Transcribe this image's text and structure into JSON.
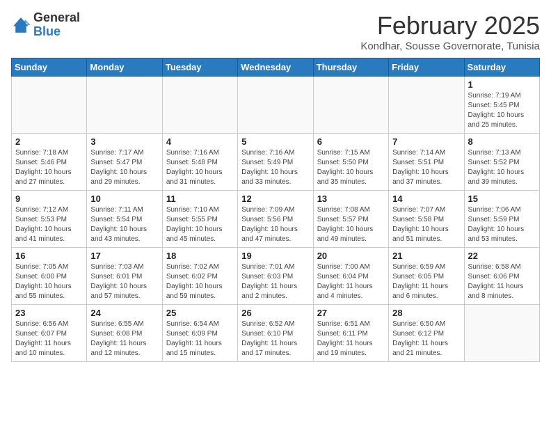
{
  "logo": {
    "general": "General",
    "blue": "Blue"
  },
  "title": "February 2025",
  "location": "Kondhar, Sousse Governorate, Tunisia",
  "days_of_week": [
    "Sunday",
    "Monday",
    "Tuesday",
    "Wednesday",
    "Thursday",
    "Friday",
    "Saturday"
  ],
  "weeks": [
    [
      {
        "day": "",
        "info": ""
      },
      {
        "day": "",
        "info": ""
      },
      {
        "day": "",
        "info": ""
      },
      {
        "day": "",
        "info": ""
      },
      {
        "day": "",
        "info": ""
      },
      {
        "day": "",
        "info": ""
      },
      {
        "day": "1",
        "info": "Sunrise: 7:19 AM\nSunset: 5:45 PM\nDaylight: 10 hours and 25 minutes."
      }
    ],
    [
      {
        "day": "2",
        "info": "Sunrise: 7:18 AM\nSunset: 5:46 PM\nDaylight: 10 hours and 27 minutes."
      },
      {
        "day": "3",
        "info": "Sunrise: 7:17 AM\nSunset: 5:47 PM\nDaylight: 10 hours and 29 minutes."
      },
      {
        "day": "4",
        "info": "Sunrise: 7:16 AM\nSunset: 5:48 PM\nDaylight: 10 hours and 31 minutes."
      },
      {
        "day": "5",
        "info": "Sunrise: 7:16 AM\nSunset: 5:49 PM\nDaylight: 10 hours and 33 minutes."
      },
      {
        "day": "6",
        "info": "Sunrise: 7:15 AM\nSunset: 5:50 PM\nDaylight: 10 hours and 35 minutes."
      },
      {
        "day": "7",
        "info": "Sunrise: 7:14 AM\nSunset: 5:51 PM\nDaylight: 10 hours and 37 minutes."
      },
      {
        "day": "8",
        "info": "Sunrise: 7:13 AM\nSunset: 5:52 PM\nDaylight: 10 hours and 39 minutes."
      }
    ],
    [
      {
        "day": "9",
        "info": "Sunrise: 7:12 AM\nSunset: 5:53 PM\nDaylight: 10 hours and 41 minutes."
      },
      {
        "day": "10",
        "info": "Sunrise: 7:11 AM\nSunset: 5:54 PM\nDaylight: 10 hours and 43 minutes."
      },
      {
        "day": "11",
        "info": "Sunrise: 7:10 AM\nSunset: 5:55 PM\nDaylight: 10 hours and 45 minutes."
      },
      {
        "day": "12",
        "info": "Sunrise: 7:09 AM\nSunset: 5:56 PM\nDaylight: 10 hours and 47 minutes."
      },
      {
        "day": "13",
        "info": "Sunrise: 7:08 AM\nSunset: 5:57 PM\nDaylight: 10 hours and 49 minutes."
      },
      {
        "day": "14",
        "info": "Sunrise: 7:07 AM\nSunset: 5:58 PM\nDaylight: 10 hours and 51 minutes."
      },
      {
        "day": "15",
        "info": "Sunrise: 7:06 AM\nSunset: 5:59 PM\nDaylight: 10 hours and 53 minutes."
      }
    ],
    [
      {
        "day": "16",
        "info": "Sunrise: 7:05 AM\nSunset: 6:00 PM\nDaylight: 10 hours and 55 minutes."
      },
      {
        "day": "17",
        "info": "Sunrise: 7:03 AM\nSunset: 6:01 PM\nDaylight: 10 hours and 57 minutes."
      },
      {
        "day": "18",
        "info": "Sunrise: 7:02 AM\nSunset: 6:02 PM\nDaylight: 10 hours and 59 minutes."
      },
      {
        "day": "19",
        "info": "Sunrise: 7:01 AM\nSunset: 6:03 PM\nDaylight: 11 hours and 2 minutes."
      },
      {
        "day": "20",
        "info": "Sunrise: 7:00 AM\nSunset: 6:04 PM\nDaylight: 11 hours and 4 minutes."
      },
      {
        "day": "21",
        "info": "Sunrise: 6:59 AM\nSunset: 6:05 PM\nDaylight: 11 hours and 6 minutes."
      },
      {
        "day": "22",
        "info": "Sunrise: 6:58 AM\nSunset: 6:06 PM\nDaylight: 11 hours and 8 minutes."
      }
    ],
    [
      {
        "day": "23",
        "info": "Sunrise: 6:56 AM\nSunset: 6:07 PM\nDaylight: 11 hours and 10 minutes."
      },
      {
        "day": "24",
        "info": "Sunrise: 6:55 AM\nSunset: 6:08 PM\nDaylight: 11 hours and 12 minutes."
      },
      {
        "day": "25",
        "info": "Sunrise: 6:54 AM\nSunset: 6:09 PM\nDaylight: 11 hours and 15 minutes."
      },
      {
        "day": "26",
        "info": "Sunrise: 6:52 AM\nSunset: 6:10 PM\nDaylight: 11 hours and 17 minutes."
      },
      {
        "day": "27",
        "info": "Sunrise: 6:51 AM\nSunset: 6:11 PM\nDaylight: 11 hours and 19 minutes."
      },
      {
        "day": "28",
        "info": "Sunrise: 6:50 AM\nSunset: 6:12 PM\nDaylight: 11 hours and 21 minutes."
      },
      {
        "day": "",
        "info": ""
      }
    ]
  ]
}
